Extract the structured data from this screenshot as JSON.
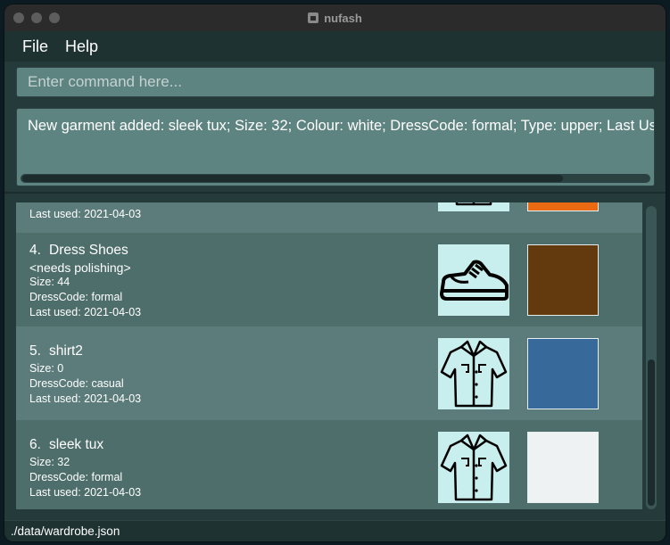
{
  "window": {
    "title": "nufash"
  },
  "menu": {
    "file": "File",
    "help": "Help"
  },
  "command": {
    "placeholder": "Enter command here..."
  },
  "result": {
    "text": "New garment added: sleek tux; Size: 32; Colour: white; DressCode: formal; Type: upper; Last Used"
  },
  "garments": [
    {
      "index": "",
      "name": "",
      "description": "",
      "size": "",
      "dress_code": "",
      "last_used": "Last used: 2021-04-03",
      "icon": "shirt-icon",
      "colour": "#e96a12"
    },
    {
      "index": "4.",
      "name": "Dress Shoes",
      "description": "<needs polishing>",
      "size": "Size: 44",
      "dress_code": "DressCode: formal",
      "last_used": "Last used: 2021-04-03",
      "icon": "shoe-icon",
      "colour": "#633a0d"
    },
    {
      "index": "5.",
      "name": "shirt2",
      "description": "",
      "size": "Size: 0",
      "dress_code": "DressCode: casual",
      "last_used": "Last used: 2021-04-03",
      "icon": "shirt-icon",
      "colour": "#37699a"
    },
    {
      "index": "6.",
      "name": "sleek tux",
      "description": "",
      "size": "Size: 32",
      "dress_code": "DressCode: formal",
      "last_used": "Last used: 2021-04-03",
      "icon": "shirt-icon",
      "colour": "#eef2f2"
    }
  ],
  "status": {
    "path": "./data/wardrobe.json"
  }
}
